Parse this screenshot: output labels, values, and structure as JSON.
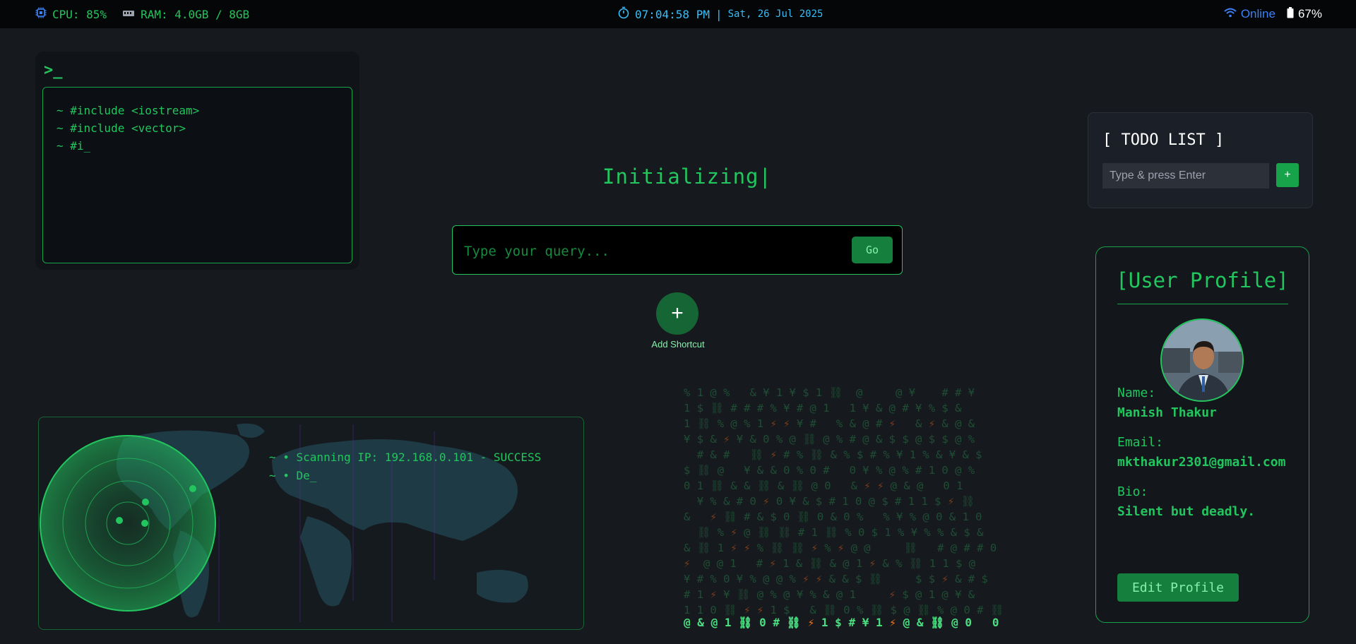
{
  "status_bar": {
    "cpu": "CPU: 85%",
    "ram": "RAM: 4.0GB / 8GB",
    "time": "07:04:58 PM",
    "separator": "|",
    "date": "Sat, 26 Jul 2025",
    "network": "Online",
    "battery": "67%"
  },
  "terminal": {
    "prompt": ">_",
    "lines": [
      "~ #include <iostream>",
      "~ #include <vector>",
      "~ #i_"
    ]
  },
  "main": {
    "typing_text": "Initializing|",
    "search_placeholder": "Type your query...",
    "go_label": "Go",
    "shortcut_icon": "+",
    "shortcut_label": "Add Shortcut"
  },
  "todo": {
    "title": "[ TODO LIST ]",
    "placeholder": "Type & press Enter",
    "add_label": "+"
  },
  "profile": {
    "title": "[User Profile]",
    "name_label": "Name:",
    "name": "Manish Thakur",
    "email_label": "Email:",
    "email": "mkthakur2301@gmail.com",
    "bio_label": "Bio:",
    "bio": "Silent but deadly.",
    "edit_label": "Edit Profile"
  },
  "scanner": {
    "lines": [
      "~ • Scanning IP: 192.168.0.101 - SUCCESS",
      "~ • De_"
    ]
  },
  "matrix_rows": [
    "% 1 @ %   & ¥ 1 ¥ $ 1 ⛓  @     @ ¥    # # ¥",
    "1 $ ⛓ # # # % ¥ # @ 1   1 ¥ & @ # ¥ % $ &",
    "1 ⛓ % @ % 1 ⚡ ⚡ ¥ #   % & @ # ⚡   & ⚡ & @ &",
    "¥ $ & ⚡ ¥ & 0 % @ ⛓ @ % # @ & $ $ @ $ $ @ %",
    "  # & #   ⛓ ⚡ # % ⛓ & % $ # % ¥ 1 % & ¥ & $",
    "$ ⛓ @   ¥ & & 0 % 0 #   0 ¥ % @ % # 1 0 @ %",
    "0 1 ⛓ & & ⛓ & ⛓ @ 0   & ⚡ ⚡ @ & @   0 1",
    "  ¥ % & # 0 ⚡ 0 ¥ & $ # 1 0 @ $ # 1 1 $ ⚡ ⛓",
    "&   ⚡ ⛓ # & $ 0 ⛓ 0 & 0 %   % ¥ % @ 0 & 1 0",
    "  ⛓ % ⚡ @ ⛓ ⛓ # 1 ⛓ % 0 $ 1 % ¥ % % & $ &",
    "& ⛓ 1 ⚡ ⚡ % ⛓ ⛓ ⚡ % ⚡ @ @     ⛓   # @ # # 0",
    "⚡  @ @ 1   # ⚡ 1 & ⛓ & @ 1 ⚡ & % ⛓ 1 1 $ @",
    "¥ # % 0 ¥ % @ @ % ⚡ ⚡ & & $ ⛓     $ $ ⚡ & # $",
    "# 1 ⚡ ¥ ⛓ @ % @ ¥ % & @ 1     ⚡ $ @ 1 @ ¥ &",
    "1 1 0 ⛓ ⚡ ⚡ 1 $   & ⛓ 0 % ⛓ $ @ ⛓ % @ 0 # ⛓"
  ],
  "matrix_last": "@ & @ 1 ⛓ 0 # ⛓ ⚡ 1 $ # ¥ 1 ⚡ @ & ⛓ @ 0   0"
}
